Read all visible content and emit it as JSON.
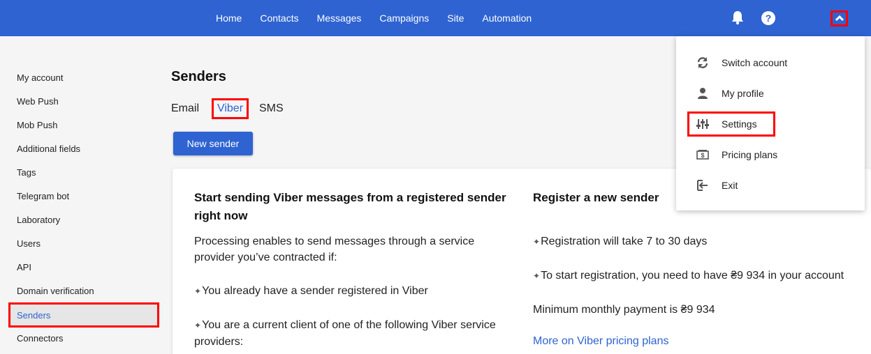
{
  "nav": {
    "items": [
      "Home",
      "Contacts",
      "Messages",
      "Campaigns",
      "Site",
      "Automation"
    ]
  },
  "icons": {
    "notifications": "bell-icon",
    "help": "help-icon",
    "account_toggle": "chevron-up-icon"
  },
  "sidebar": {
    "items": [
      {
        "label": "My account"
      },
      {
        "label": "Web Push"
      },
      {
        "label": "Mob Push"
      },
      {
        "label": "Additional fields"
      },
      {
        "label": "Tags"
      },
      {
        "label": "Telegram bot"
      },
      {
        "label": "Laboratory"
      },
      {
        "label": "Users"
      },
      {
        "label": "API"
      },
      {
        "label": "Domain verification"
      },
      {
        "label": "Senders",
        "active": true
      },
      {
        "label": "Connectors"
      }
    ]
  },
  "main": {
    "title": "Senders",
    "tabs": [
      "Email",
      "Viber",
      "SMS"
    ],
    "active_tab": "Viber",
    "new_sender_label": "New sender",
    "left": {
      "heading": "Start sending Viber messages from a registered sender right now",
      "intro": "Processing enables to send messages through a service provider you’ve contracted if:",
      "bullet1": "You already have a sender registered in Viber",
      "bullet2": "You are a current client of one of the following Viber service providers:"
    },
    "right": {
      "heading": "Register a new sender",
      "bullet1": "Registration will take 7 to 30 days",
      "bullet2": "To start registration, you need to have ₴9 934 in your account",
      "min_payment": "Minimum monthly payment is ₴9 934",
      "link": "More on Viber pricing plans"
    }
  },
  "dropdown": {
    "items": [
      {
        "label": "Switch account",
        "icon": "refresh-icon"
      },
      {
        "label": "My profile",
        "icon": "person-icon"
      },
      {
        "label": "Settings",
        "icon": "sliders-icon"
      },
      {
        "label": "Pricing plans",
        "icon": "money-icon"
      },
      {
        "label": "Exit",
        "icon": "exit-icon"
      }
    ]
  },
  "colors": {
    "primary": "#2e63d1",
    "highlight": "#ff0000",
    "background": "#f5f5f5"
  }
}
